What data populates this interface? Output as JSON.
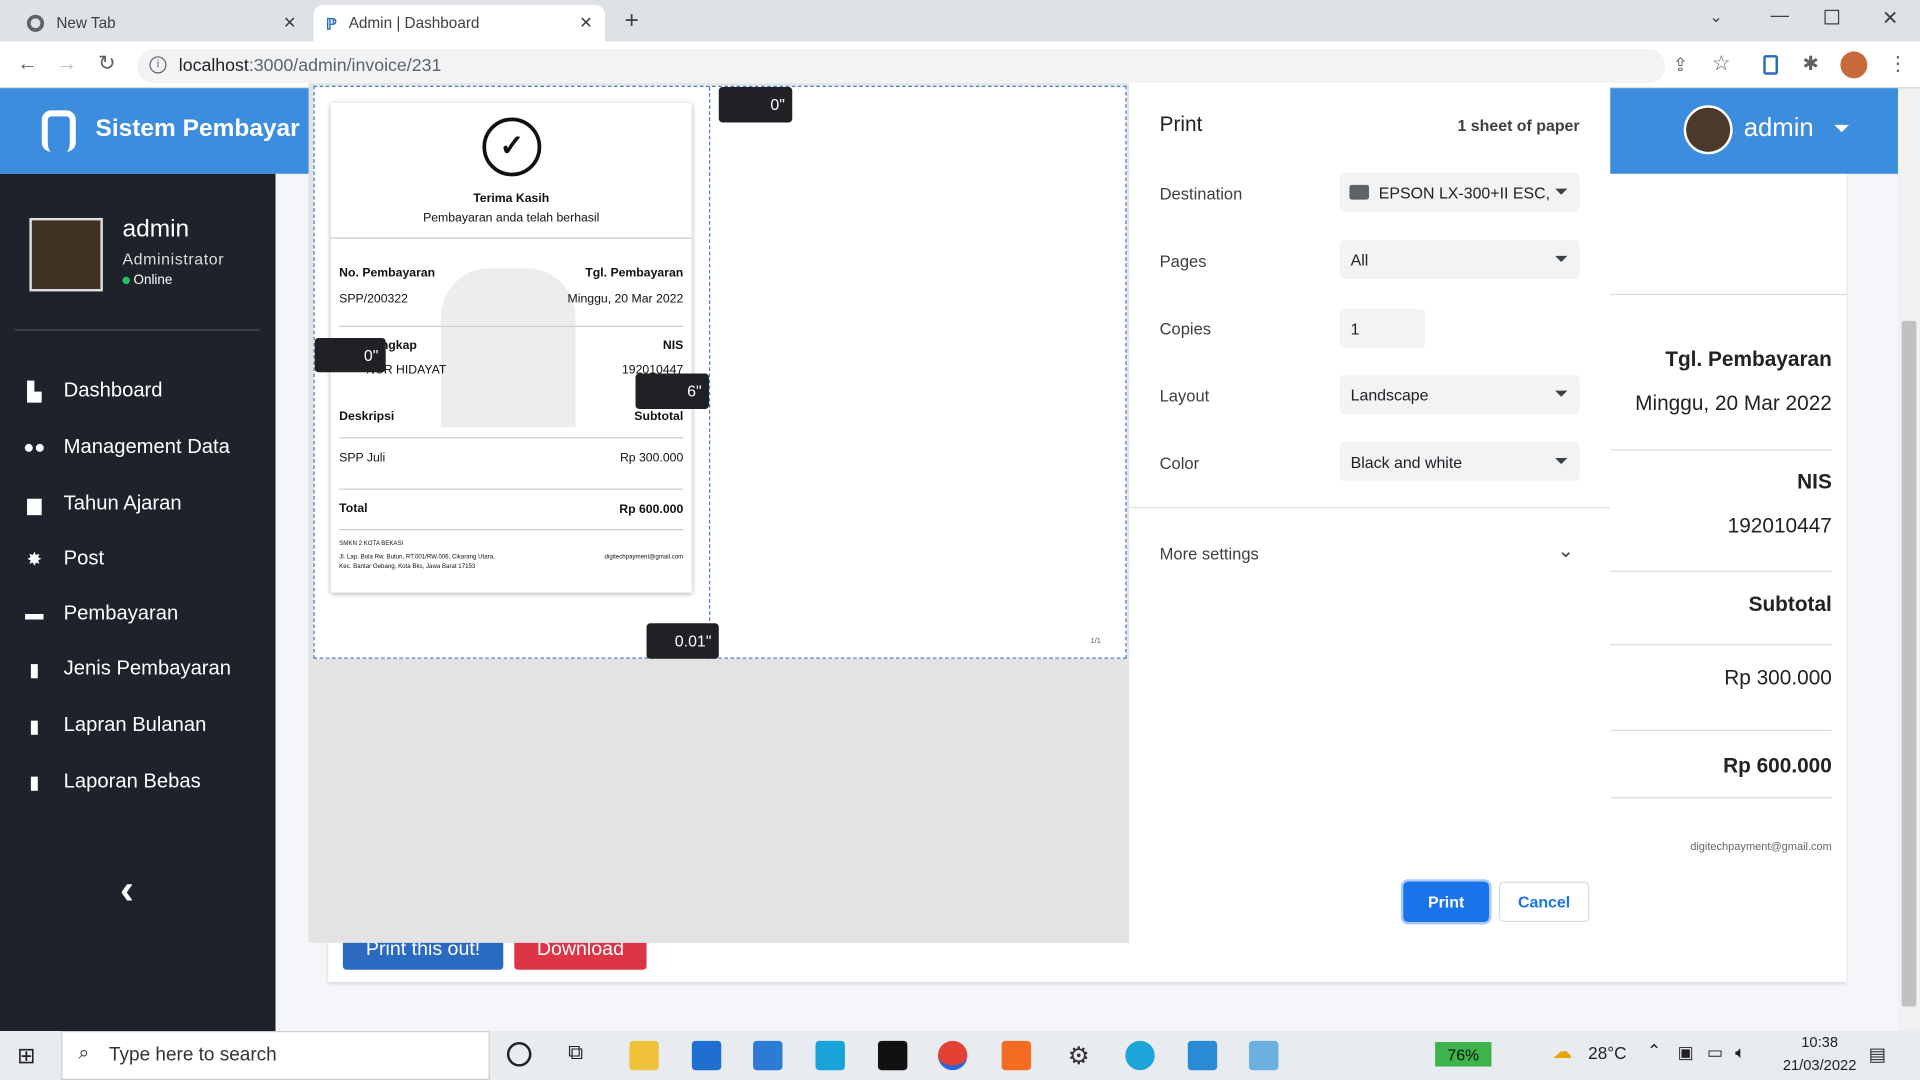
{
  "browser": {
    "tabs": [
      {
        "label": "New Tab"
      },
      {
        "label": "Admin | Dashboard"
      }
    ],
    "url_host": "localhost",
    "url_path": ":3000/admin/invoice/231"
  },
  "app": {
    "brand": "Sistem Pembayar",
    "header_user": "admin"
  },
  "user": {
    "name": "admin",
    "role": "Administrator",
    "status": "Online"
  },
  "sidebar": {
    "items": [
      {
        "label": "Dashboard",
        "icon": "chart-icon"
      },
      {
        "label": "Management Data",
        "icon": "users-icon"
      },
      {
        "label": "Tahun Ajaran",
        "icon": "calendar-icon"
      },
      {
        "label": "Post",
        "icon": "gear-icon"
      },
      {
        "label": "Pembayaran",
        "icon": "card-icon"
      },
      {
        "label": "Jenis Pembayaran",
        "icon": "book-icon"
      },
      {
        "label": "Lapran Bulanan",
        "icon": "book-icon"
      },
      {
        "label": "Laporan Bebas",
        "icon": "book-icon"
      }
    ]
  },
  "invoice_right": {
    "tgl_label": "Tgl. Pembayaran",
    "tgl_value": "Minggu, 20 Mar 2022",
    "nis_label": "NIS",
    "nis_value": "192010447",
    "subtotal_label": "Subtotal",
    "subtotal_value": "Rp 300.000",
    "total_value": "Rp 600.000",
    "email": "digitechpayment@gmail.com"
  },
  "actions": {
    "print_btn": "Print this out!",
    "download_btn": "Download"
  },
  "receipt": {
    "title": "Terima Kasih",
    "subtitle": "Pembayaran anda telah berhasil",
    "no_label": "No. Pembayaran",
    "no_value": "SPP/200322",
    "tgl_label": "Tgl. Pembayaran",
    "tgl_value": "Minggu, 20 Mar 2022",
    "nama_label": "ngkap",
    "nama_value": "NUR HIDAYAT",
    "nis_label": "NIS",
    "nis_value": "192010447",
    "desk_label": "Deskripsi",
    "subtotal_label": "Subtotal",
    "item": "SPP Juli",
    "item_value": "Rp 300.000",
    "total_label": "Total",
    "total_value": "Rp 600.000",
    "school": "SMKN 2 KOTA BEKASI",
    "address1": "Jl. Lap. Bola Rw. Butun, RT.001/RW.006, Cikarang Utara,",
    "address2": "Kec. Bantar Gebang, Kota Bks, Jawa Barat 17153",
    "email": "digitechpayment@gmail.com",
    "page_num": "1/1"
  },
  "margins": {
    "top": "0\"",
    "left": "0\"",
    "right": "6\"",
    "bottom": "0.01\""
  },
  "print_dialog": {
    "title": "Print",
    "sheets": "1 sheet of paper",
    "destination_label": "Destination",
    "destination": "EPSON LX-300+II ESC,",
    "pages_label": "Pages",
    "pages": "All",
    "copies_label": "Copies",
    "copies": "1",
    "layout_label": "Layout",
    "layout": "Landscape",
    "color_label": "Color",
    "color": "Black and white",
    "more": "More settings",
    "print_btn": "Print",
    "cancel_btn": "Cancel"
  },
  "taskbar": {
    "search": "Type here to search",
    "battery": "76%",
    "weather": "28°C",
    "time": "10:38",
    "date": "21/03/2022"
  }
}
